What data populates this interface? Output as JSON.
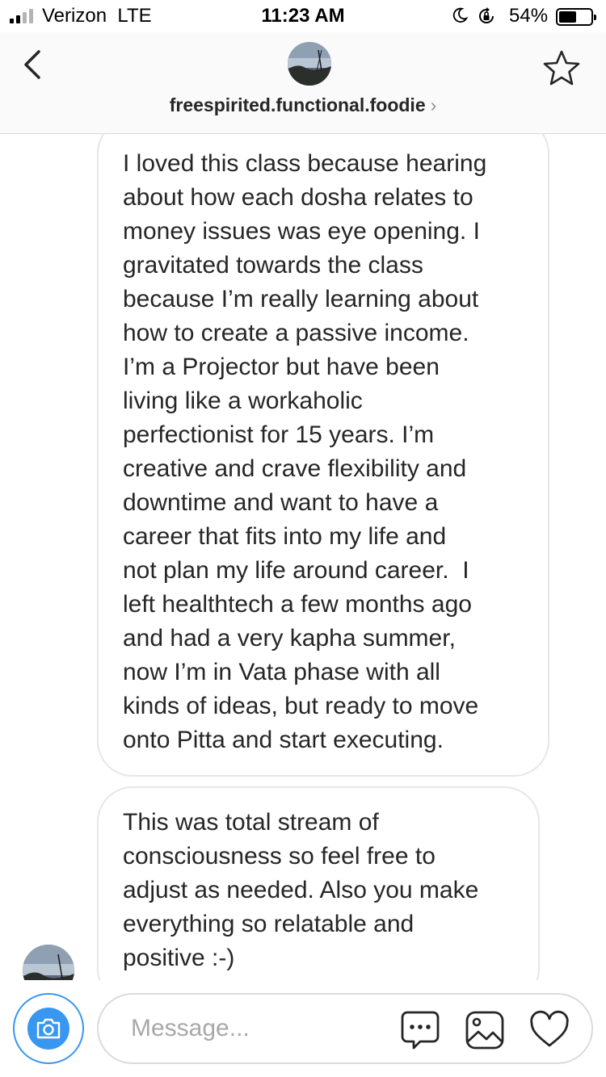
{
  "status_bar": {
    "carrier": "Verizon",
    "network": "LTE",
    "time": "11:23 AM",
    "battery_percent": "54%",
    "battery_level": 0.54,
    "signal_bars_filled": 2,
    "signal_bars_total": 4
  },
  "header": {
    "username": "freespirited.functional.foodie",
    "chevron": "›"
  },
  "messages": [
    {
      "text": "I loved this class because hearing\nabout how each dosha relates to\nmoney issues was eye opening. I\ngravitated towards the class\nbecause I’m really learning about\nhow to create a passive income.\nI’m a Projector but have been\nliving like a workaholic\nperfectionist for 15 years. I’m\ncreative and crave flexibility and\ndowntime and want to have a\ncareer that fits into my life and\nnot plan my life around career.  I\nleft healthtech a few months ago\nand had a very kapha summer,\nnow I’m in Vata phase with all\nkinds of ideas, but ready to move\nonto Pitta and start executing."
    },
    {
      "text": "This was total stream of\nconsciousness so feel free to\nadjust as needed. Also you make\neverything so relatable and\npositive :-)"
    }
  ],
  "composer": {
    "placeholder": "Message..."
  },
  "colors": {
    "accent": "#3897f0",
    "border": "#dbdbdb",
    "header_bg": "#fafafa",
    "text": "#262626"
  },
  "icons": [
    "back-arrow-icon",
    "star-icon",
    "camera-icon",
    "chat-bubble-icon",
    "photo-gallery-icon",
    "heart-icon",
    "moon-icon",
    "orientation-lock-icon"
  ]
}
